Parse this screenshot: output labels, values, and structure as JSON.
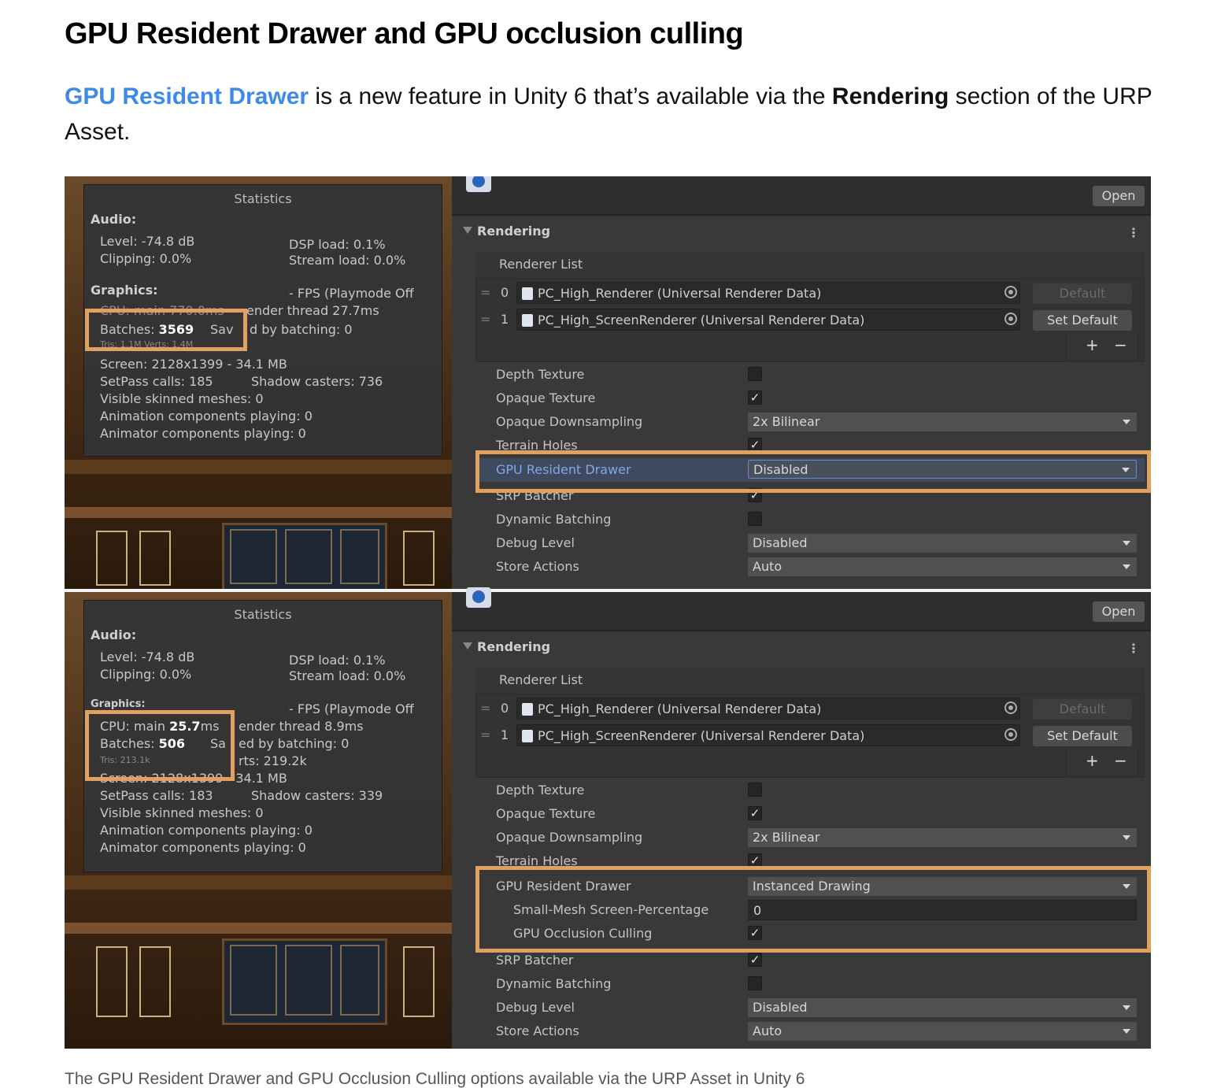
{
  "article": {
    "heading": "GPU Resident Drawer and GPU occlusion culling",
    "intro_link": "GPU Resident Drawer",
    "intro_text_1": " is a new feature in Unity 6 that’s available via the ",
    "intro_bold": "Rendering",
    "intro_text_2": " section of the URP Asset.",
    "caption": "The GPU Resident Drawer and GPU Occlusion Culling options available via the URP Asset in Unity 6"
  },
  "highlight_color": "#e0a060",
  "top_panel": {
    "stats": {
      "title": "Statistics",
      "audio_header": "Audio:",
      "level": "Level: -74.8 dB",
      "clipping": "Clipping: 0.0%",
      "dsp": "DSP load: 0.1%",
      "stream": "Stream load: 0.0%",
      "graphics_header": "Graphics:",
      "fps": "- FPS (Playmode Off",
      "cpu_partial": "CPU: main 770.0ms",
      "render_thread": "ender thread 27.7ms",
      "batches_label": "Batches: ",
      "batches_value": "3569",
      "saved_a": "Sav",
      "saved_b": "d by batching: 0",
      "tris_partial": "Tris: 1.1M  Verts: 1.4M",
      "screen": "Screen: 2128x1399 - 34.1 MB",
      "setpass": "SetPass calls: 185",
      "shadow": "Shadow casters: 736",
      "skinned": "Visible skinned meshes: 0",
      "animation": "Animation components playing: 0",
      "animator": "Animator components playing: 0"
    },
    "inspector": {
      "open": "Open",
      "section": "Rendering",
      "kebab": "⋮",
      "renderer_list": "Renderer List",
      "renderers": [
        {
          "index": "0",
          "name": "PC_High_Renderer (Universal Renderer Data)",
          "button": "Default"
        },
        {
          "index": "1",
          "name": "PC_High_ScreenRenderer (Universal Renderer Data)",
          "button": "Set Default"
        }
      ],
      "plus": "+",
      "minus": "−",
      "depth_texture": "Depth Texture",
      "opaque_texture": "Opaque Texture",
      "opaque_downsampling": "Opaque Downsampling",
      "opaque_downsampling_value": "2x Bilinear",
      "terrain_holes": "Terrain Holes",
      "gpu_resident_drawer": "GPU Resident Drawer",
      "gpu_resident_drawer_value": "Disabled",
      "srp_batcher": "SRP Batcher",
      "dynamic_batching": "Dynamic Batching",
      "debug_level": "Debug Level",
      "debug_level_value": "Disabled",
      "store_actions": "Store Actions",
      "store_actions_value": "Auto",
      "check": "✓"
    }
  },
  "bottom_panel": {
    "stats": {
      "title": "Statistics",
      "audio_header": "Audio:",
      "level": "Level: -74.8 dB",
      "clipping": "Clipping: 0.0%",
      "dsp": "DSP load: 0.1%",
      "stream": "Stream load: 0.0%",
      "graphics_header": "Graphics:",
      "fps": "- FPS (Playmode Off",
      "cpu_label": "CPU: main ",
      "cpu_value": "25.7",
      "cpu_unit": "ms",
      "render_thread": "ender thread 8.9ms",
      "batches_label": "Batches: ",
      "batches_value": "506",
      "saved_a": "Sa",
      "saved_b": "ed by batching: 0",
      "tris_partial": "Tris: 213.1k",
      "verts_partial": "rts: 219.2k",
      "screen": "Screen: 2128x1399 - 34.1 MB",
      "setpass": "SetPass calls: 183",
      "shadow": "Shadow casters: 339",
      "skinned": "Visible skinned meshes: 0",
      "animation": "Animation components playing: 0",
      "animator": "Animator components playing: 0"
    },
    "inspector": {
      "open": "Open",
      "section": "Rendering",
      "kebab": "⋮",
      "renderer_list": "Renderer List",
      "renderers": [
        {
          "index": "0",
          "name": "PC_High_Renderer (Universal Renderer Data)",
          "button": "Default"
        },
        {
          "index": "1",
          "name": "PC_High_ScreenRenderer (Universal Renderer Data)",
          "button": "Set Default"
        }
      ],
      "plus": "+",
      "minus": "−",
      "depth_texture": "Depth Texture",
      "opaque_texture": "Opaque Texture",
      "opaque_downsampling": "Opaque Downsampling",
      "opaque_downsampling_value": "2x Bilinear",
      "terrain_holes": "Terrain Holes",
      "gpu_resident_drawer": "GPU Resident Drawer",
      "gpu_resident_drawer_value": "Instanced Drawing",
      "small_mesh": "Small-Mesh Screen-Percentage",
      "small_mesh_value": "0",
      "gpu_occlusion_culling": "GPU Occlusion Culling",
      "srp_batcher": "SRP Batcher",
      "dynamic_batching": "Dynamic Batching",
      "debug_level": "Debug Level",
      "debug_level_value": "Disabled",
      "store_actions": "Store Actions",
      "store_actions_value": "Auto",
      "check": "✓"
    }
  }
}
